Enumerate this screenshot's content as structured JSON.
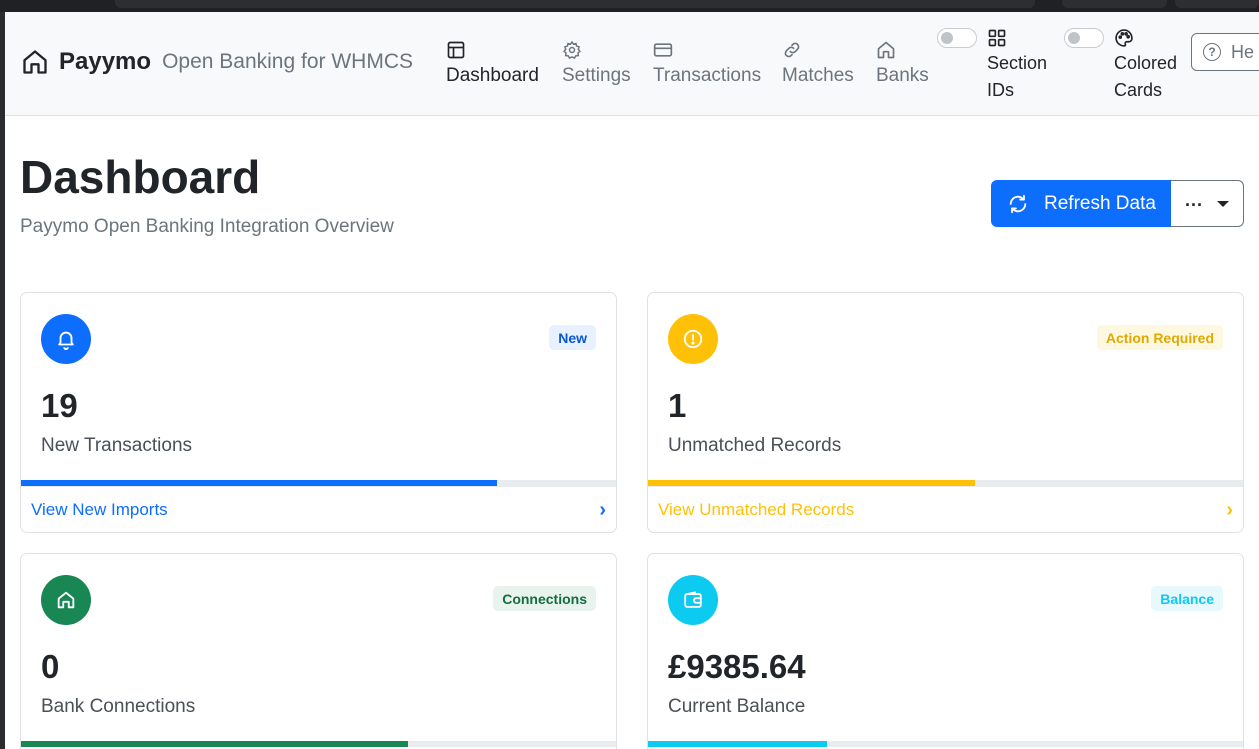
{
  "brand": {
    "name": "Payymo",
    "subtitle": "Open Banking for WHMCS"
  },
  "nav": {
    "items": [
      {
        "label": "Dashboard",
        "icon": "layout-icon",
        "active": true
      },
      {
        "label": "Settings",
        "icon": "gear-icon",
        "active": false
      },
      {
        "label": "Transactions",
        "icon": "credit-card-icon",
        "active": false
      },
      {
        "label": "Matches",
        "icon": "link-icon",
        "active": false
      },
      {
        "label": "Banks",
        "icon": "bank-icon",
        "active": false
      }
    ],
    "toggles": [
      {
        "label_line1": "Section",
        "label_line2": "IDs",
        "icon": "grid-icon",
        "on": false
      },
      {
        "label_line1": "Colored",
        "label_line2": "Cards",
        "icon": "palette-icon",
        "on": false
      }
    ],
    "help_label": "He"
  },
  "page": {
    "title": "Dashboard",
    "subtitle": "Payymo Open Banking Integration Overview",
    "refresh_label": "Refresh Data",
    "more_label": "..."
  },
  "cards": [
    {
      "value": "19",
      "label": "New Transactions",
      "badge": "New",
      "link": "View New Imports",
      "icon": "bell-icon",
      "progress": 0.8,
      "color": "#0d6efd",
      "badge_bg": "#e7f1ff",
      "link_color": "#0d6efd"
    },
    {
      "value": "1",
      "label": "Unmatched Records",
      "badge": "Action Required",
      "link": "View Unmatched Records",
      "icon": "alert-circle-icon",
      "progress": 0.55,
      "color": "#ffc107",
      "badge_bg": "#fff8e1",
      "link_color": "#ffc107"
    },
    {
      "value": "0",
      "label": "Bank Connections",
      "badge": "Connections",
      "link": "",
      "icon": "bank-icon",
      "progress": 0.65,
      "color": "#198754",
      "badge_bg": "#e8f3ee",
      "link_color": "#198754"
    },
    {
      "value": "£9385.64",
      "label": "Current Balance",
      "badge": "Balance",
      "link": "",
      "icon": "wallet-icon",
      "progress": 0.3,
      "color": "#0dcaf0",
      "badge_bg": "#e7f9fd",
      "link_color": "#0dcaf0"
    }
  ]
}
